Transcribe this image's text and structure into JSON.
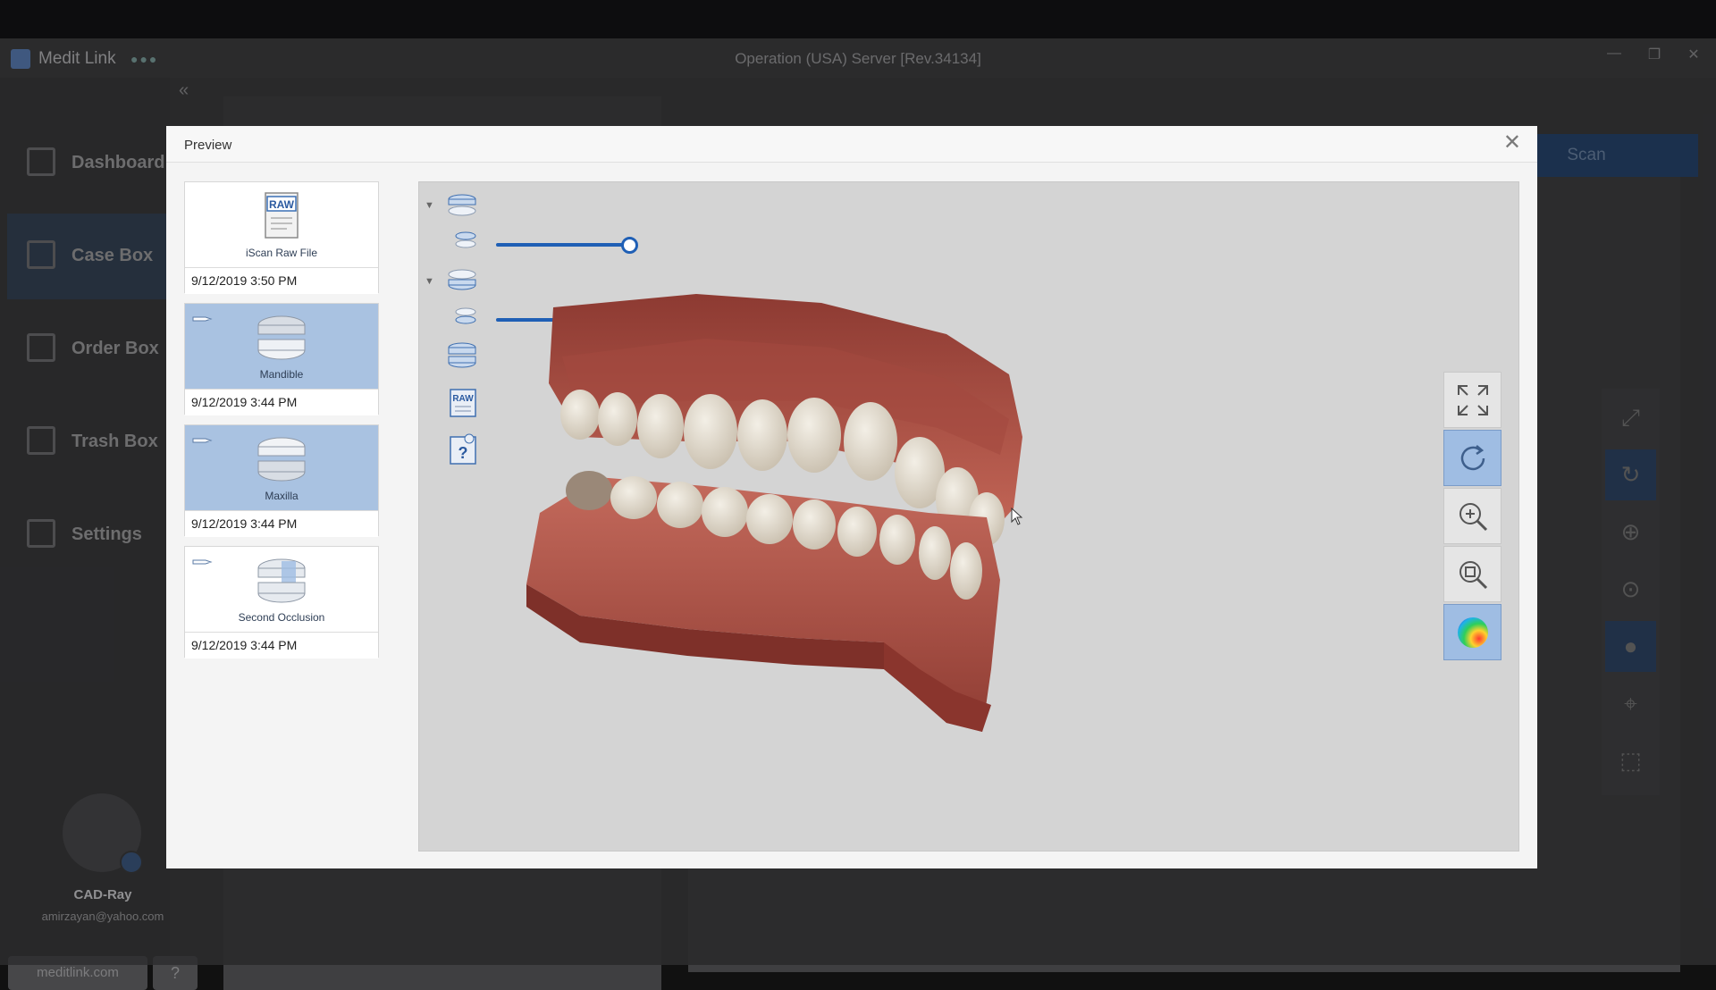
{
  "app": {
    "name": "Medit Link",
    "status_dots": "●●●",
    "server_title": "Operation (USA) Server [Rev.34134]",
    "collapse_icon": "«",
    "window_controls": {
      "minimize": "—",
      "restore": "❐",
      "close": "✕"
    }
  },
  "sidebar": {
    "items": [
      {
        "label": "Dashboard",
        "icon": "dashboard-icon"
      },
      {
        "label": "Case Box",
        "icon": "case-box-icon",
        "active": true
      },
      {
        "label": "Order Box",
        "icon": "order-box-icon"
      },
      {
        "label": "Trash Box",
        "icon": "trash-box-icon"
      },
      {
        "label": "Settings",
        "icon": "settings-icon"
      }
    ],
    "user": {
      "name": "CAD-Ray",
      "email": "amirzayan@yahoo.com"
    },
    "link_label": "meditlink.com",
    "help_icon": "?"
  },
  "background": {
    "scan_label": "Scan"
  },
  "dialog": {
    "title": "Preview",
    "close_icon": "✕",
    "files": [
      {
        "label": "iScan Raw File",
        "date": "9/12/2019 3:50 PM",
        "selected": false,
        "icon": "raw-file-icon"
      },
      {
        "label": "Mandible",
        "date": "9/12/2019 3:44 PM",
        "selected": true,
        "icon": "mandible-icon"
      },
      {
        "label": "Maxilla",
        "date": "9/12/2019 3:44 PM",
        "selected": true,
        "icon": "maxilla-icon"
      },
      {
        "label": "Second Occlusion",
        "date": "9/12/2019 3:44 PM",
        "selected": false,
        "icon": "occlusion-icon"
      }
    ],
    "tree": {
      "raw_icon_text": "RAW",
      "unknown_icon_text": "?",
      "opacity_sliders": [
        1.0,
        1.0
      ]
    },
    "toolbar": [
      "fit-screen-icon",
      "reset-view-icon",
      "zoom-in-icon",
      "zoom-fit-icon",
      "color-texture-icon"
    ]
  },
  "colors": {
    "accent": "#1f5fb5",
    "selected_card": "#a9c2e1",
    "sidebar_active": "#354456",
    "gum": "#b8594b",
    "tooth": "#e4dccd"
  }
}
